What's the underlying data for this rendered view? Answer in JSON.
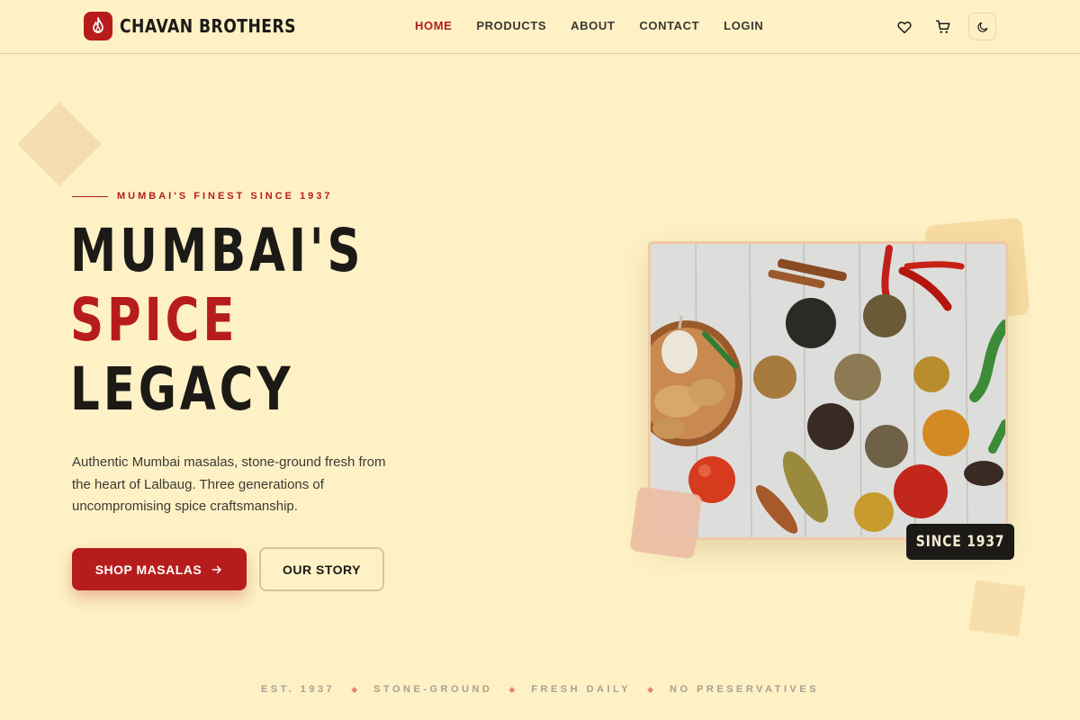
{
  "header": {
    "brand": "CHAVAN BROTHERS",
    "nav": [
      {
        "label": "HOME",
        "active": true
      },
      {
        "label": "PRODUCTS",
        "active": false
      },
      {
        "label": "ABOUT",
        "active": false
      },
      {
        "label": "CONTACT",
        "active": false
      },
      {
        "label": "LOGIN",
        "active": false
      }
    ],
    "icons": [
      "heart-icon",
      "cart-icon",
      "moon-icon"
    ]
  },
  "hero": {
    "tagline": "MUMBAI'S FINEST SINCE 1937",
    "title_line1": "MUMBAI'S",
    "title_line2": "SPICE",
    "title_line3": "LEGACY",
    "description": "Authentic Mumbai masalas, stone-ground fresh from the heart of Lalbaug. Three generations of uncompromising spice craftsmanship.",
    "primary_button": "SHOP MASALAS",
    "secondary_button": "OUR STORY"
  },
  "image_card": {
    "badge": "SINCE 1937"
  },
  "features": [
    "EST. 1937",
    "STONE-GROUND",
    "FRESH DAILY",
    "NO PRESERVATIVES"
  ],
  "colors": {
    "background": "#fdf1c5",
    "accent": "#b71c1c",
    "text": "#1c1a17",
    "muted": "#a7a191"
  }
}
